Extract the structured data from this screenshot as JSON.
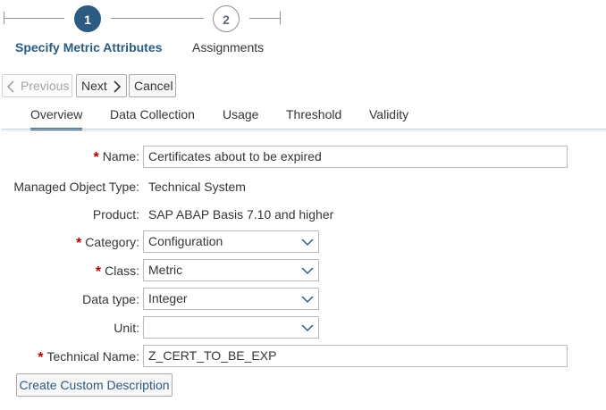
{
  "wizard": {
    "steps": [
      {
        "number": "1",
        "label": "Specify Metric Attributes",
        "state": "active"
      },
      {
        "number": "2",
        "label": "Assignments",
        "state": "inactive"
      }
    ]
  },
  "toolbar": {
    "previous_label": "Previous",
    "next_label": "Next",
    "cancel_label": "Cancel"
  },
  "tabs": [
    {
      "label": "Overview",
      "selected": true
    },
    {
      "label": "Data Collection",
      "selected": false
    },
    {
      "label": "Usage",
      "selected": false
    },
    {
      "label": "Threshold",
      "selected": false
    },
    {
      "label": "Validity",
      "selected": false
    }
  ],
  "form": {
    "required_marker": "*",
    "name": {
      "label": "Name:",
      "value": "Certificates about to be expired"
    },
    "managed_object_type": {
      "label": "Managed Object Type:",
      "value": "Technical System"
    },
    "product": {
      "label": "Product:",
      "value": "SAP ABAP Basis 7.10 and higher"
    },
    "category": {
      "label": "Category:",
      "value": "Configuration"
    },
    "class": {
      "label": "Class:",
      "value": "Metric"
    },
    "data_type": {
      "label": "Data type:",
      "value": "Integer"
    },
    "unit": {
      "label": "Unit:",
      "value": ""
    },
    "technical_name": {
      "label": "Technical Name:",
      "value": "Z_CERT_TO_BE_EXP"
    },
    "custom_description_label": "Create Custom Description"
  },
  "colors": {
    "accent": "#2b5a82",
    "required": "#bb0000",
    "border": "#b8bcc0"
  }
}
